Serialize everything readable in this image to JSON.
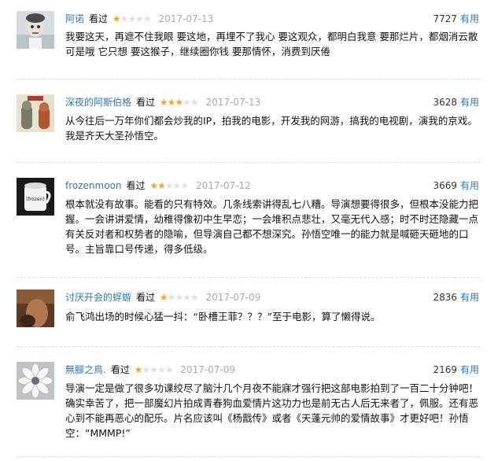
{
  "watched_label": "看过",
  "useful_label": "有用",
  "colors": {
    "author": "#3377aa",
    "star": "#f6a623",
    "date": "#aaaaaa"
  },
  "reviews": [
    {
      "author": "阿诺",
      "rating": 1,
      "date": "2017-07-13",
      "votes": "7727",
      "content": "我要这天，再遮不住我眼 要这地，再埋不了我心 要这观众，都明白我意 要那烂片，都烟消云散 可是哦 它只想 要这猴子，继续圈你钱 要那情怀，消费到厌倦"
    },
    {
      "author": "深夜的阿斯伯格",
      "rating": 3,
      "date": "2017-07-13",
      "votes": "3628",
      "content": "从今往后一万年你们都会炒我的IP，拍我的电影，开发我的网游，搞我的电视剧，演我的京戏。我是齐天大圣孙悟空。"
    },
    {
      "author": "frozenmoon",
      "rating": 2,
      "date": "2017-07-12",
      "votes": "3669",
      "content": "根本就没有故事。能看的只有特效。几条线索讲得乱七八糟。导演想要得很多，但根本没能力把握。一会讲讲爱情，幼稚得像初中生早恋；一会堆积点悲壮，又毫无代入感；时不时还隐藏一点有关反对者和权势者的隐喻，但导演自己都不想深究。孙悟空唯一的能力就是喊砸天砸地的口号。主旨靠口号传递，得多低级。",
      "avatar_text": "(frozen)"
    },
    {
      "author": "讨厌开会的蜉蝣",
      "rating": 1,
      "date": "2017-07-09",
      "votes": "2836",
      "content": "俞飞鸿出场的时候心猛一抖：“卧槽王菲？？？”至于电影，算了懒得说。"
    },
    {
      "author": "無腳之鳥.",
      "rating": 1,
      "date": "2017-07-09",
      "votes": "2169",
      "content": "导演一定是做了很多功课绞尽了脑汁几个月夜不能寐才强行把这部电影拍到了一百二十分钟吧！确实幸苦了，把一部魔幻片拍成青春狗血爱情片这功力也是前无古人后无来者了，佩服。还有恶心到不能再恶心的配乐。片名应该叫《杨戬传》或者《天蓬元帅的爱情故事》才更好吧！孙悟空：“MMMP!”"
    }
  ]
}
